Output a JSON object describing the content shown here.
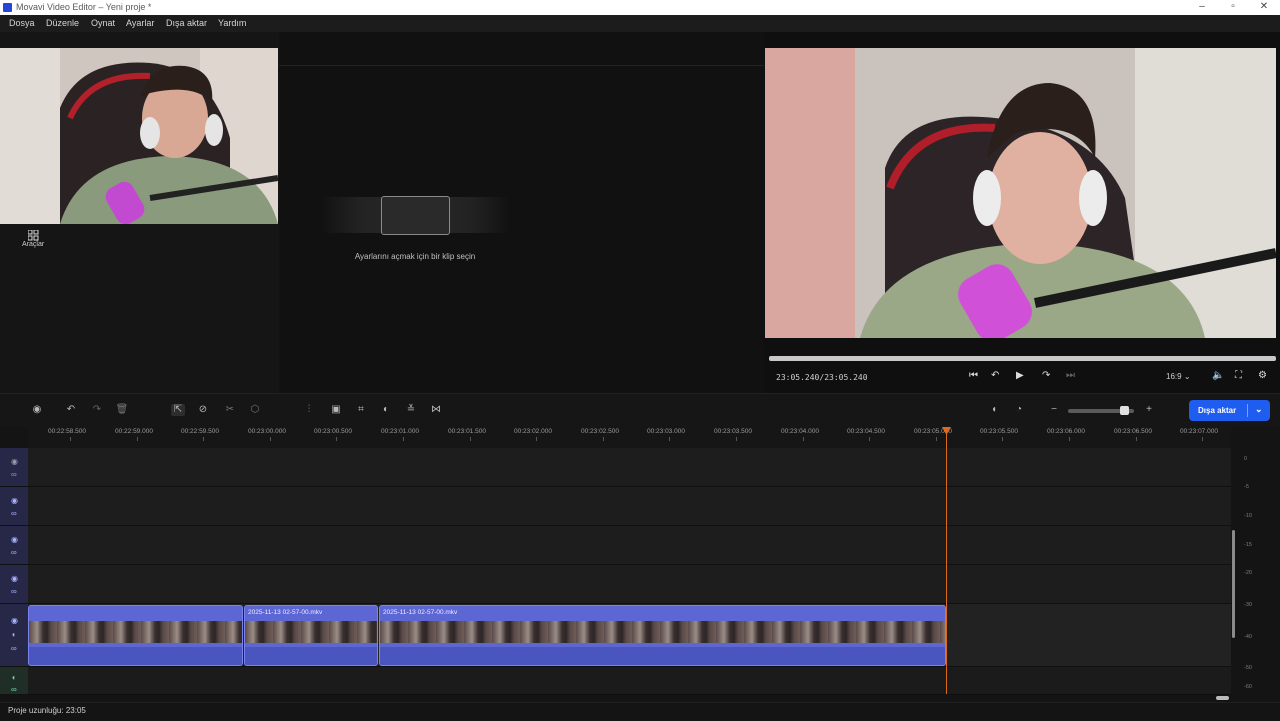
{
  "window": {
    "title": "Movavi Video Editor – Yeni proje *",
    "minimize": "–",
    "maximize": "▫",
    "close": "✕"
  },
  "menu": {
    "items": [
      "Dosya",
      "Düzenle",
      "Oynat",
      "Ayarlar",
      "Dışa aktar",
      "Yardım"
    ]
  },
  "left_panel": {
    "tools_label": "Araçlar"
  },
  "clip_settings": {
    "hint": "Ayarlarını açmak için bir klip seçin"
  },
  "player": {
    "timecode_current": "23:05.240",
    "timecode_total": "23:05.240",
    "timecode_separator": "/",
    "aspect_ratio": "16:9"
  },
  "toolbar": {
    "export_label": "Dışa aktar"
  },
  "ruler": {
    "ticks": [
      "00:22:58.500",
      "00:22:59.000",
      "00:22:59.500",
      "00:23:00.000",
      "00:23:00.500",
      "00:23:01.000",
      "00:23:01.500",
      "00:23:02.000",
      "00:23:02.500",
      "00:23:03.000",
      "00:23:03.500",
      "00:23:04.000",
      "00:23:04.500",
      "00:23:05.000",
      "00:23:05.500",
      "00:23:06.000",
      "00:23:06.500",
      "00:23:07.000"
    ]
  },
  "timeline": {
    "clips": [
      {
        "label": ""
      },
      {
        "label": "2025-11-13 02-57-00.mkv"
      },
      {
        "label": "2025-11-13 02-57-00.mkv"
      }
    ]
  },
  "vu_meter": {
    "labels": [
      "0",
      "-5",
      "-10",
      "-15",
      "-20",
      "-30",
      "-40",
      "-50",
      "-60"
    ]
  },
  "status": {
    "project_length": "Proje uzunluğu: 23:05"
  },
  "colors": {
    "accent": "#1f5cf0",
    "playhead": "#e06a1c",
    "clip": "#5c67d4"
  }
}
